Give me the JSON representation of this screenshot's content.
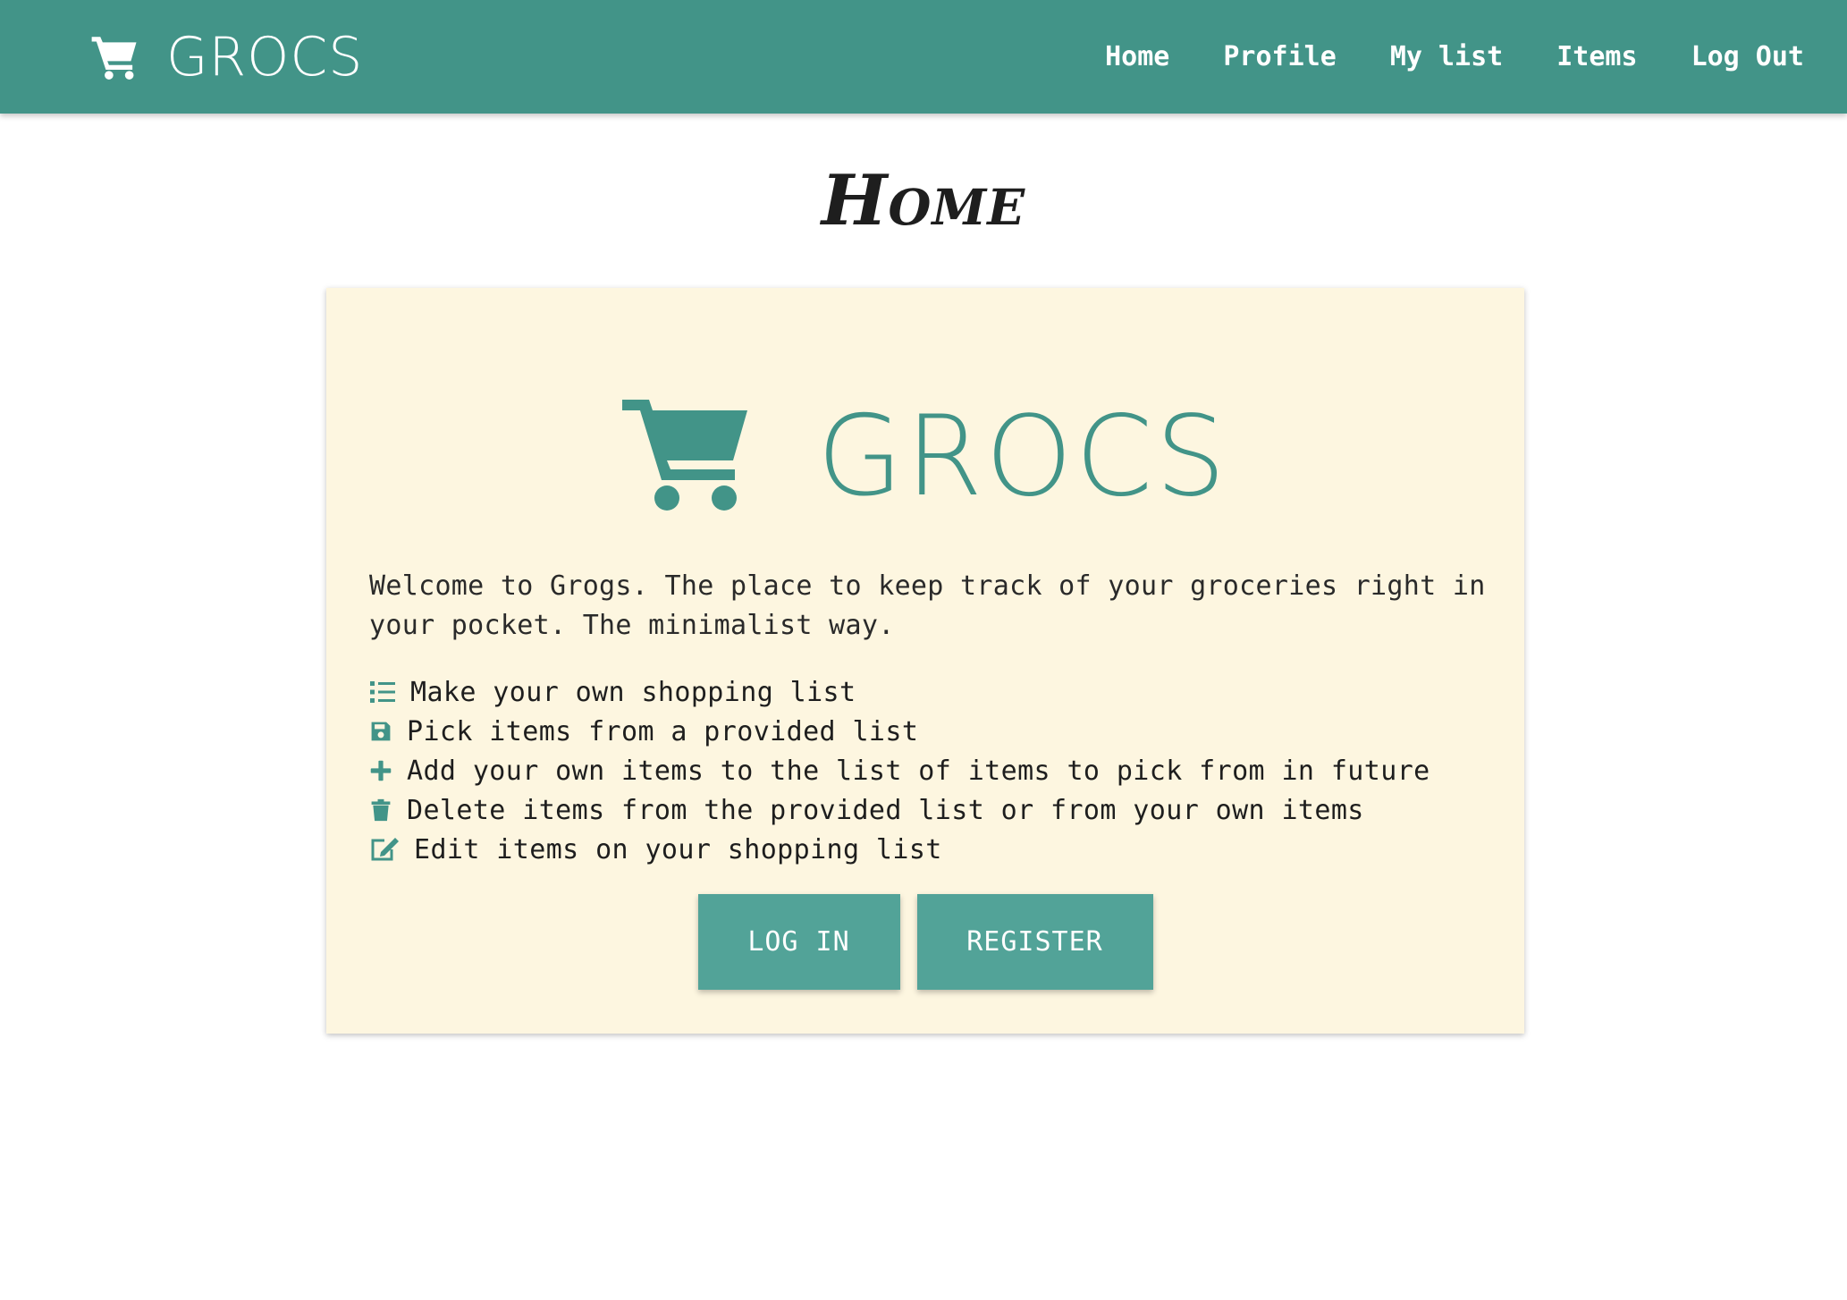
{
  "brand": {
    "name": "GROCS",
    "icon": "shopping-cart-icon"
  },
  "nav": {
    "items": [
      {
        "label": "Home"
      },
      {
        "label": "Profile"
      },
      {
        "label": "My list"
      },
      {
        "label": "Items"
      },
      {
        "label": "Log Out"
      }
    ]
  },
  "page": {
    "title": "Home"
  },
  "card": {
    "hero_title": "GROCS",
    "hero_icon": "shopping-cart-icon",
    "welcome_text": "Welcome to Grogs. The place to keep track of your groceries right in your pocket. The minimalist way.",
    "features": [
      {
        "icon": "list-icon",
        "text": "Make your own shopping list"
      },
      {
        "icon": "save-icon",
        "text": "Pick items from a provided list"
      },
      {
        "icon": "plus-icon",
        "text": "Add your own items to the list of items to pick from in future"
      },
      {
        "icon": "trash-icon",
        "text": "Delete items from the provided list or from your own items"
      },
      {
        "icon": "edit-icon",
        "text": "Edit items on your shopping list"
      }
    ],
    "buttons": {
      "login": "LOG IN",
      "register": "REGISTER"
    }
  },
  "colors": {
    "primary": "#429488",
    "button": "#52a398",
    "card_background": "#fdf6e0",
    "page_background": "#ffffff"
  }
}
